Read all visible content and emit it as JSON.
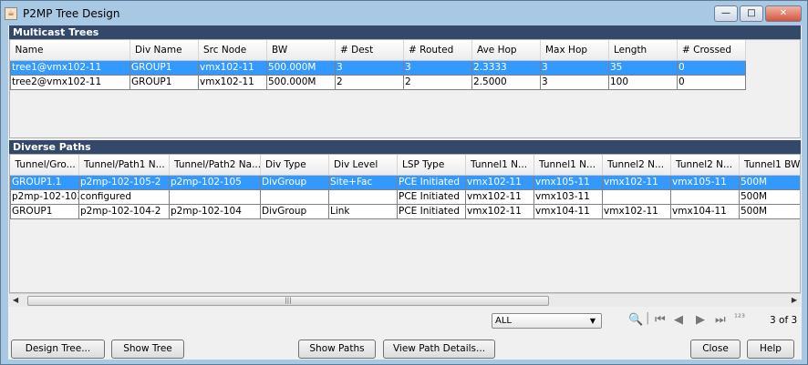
{
  "window": {
    "title": "P2MP Tree Design",
    "minimize": "—",
    "maximize": "□",
    "close": "✕"
  },
  "multicast": {
    "title": "Multicast Trees",
    "columns": [
      "Name",
      "Div Name",
      "Src Node",
      "BW",
      "# Dest",
      "# Routed",
      "Ave Hop",
      "Max Hop",
      "Length",
      "# Crossed"
    ],
    "rows": [
      [
        "tree1@vmx102-11",
        "GROUP1",
        "vmx102-11",
        "500.000M",
        "3",
        "3",
        "2.3333",
        "3",
        "35",
        "0"
      ],
      [
        "tree2@vmx102-11",
        "GROUP1",
        "vmx102-11",
        "500.000M",
        "2",
        "2",
        "2.5000",
        "3",
        "100",
        "0"
      ]
    ],
    "selected_row": 0
  },
  "diverse": {
    "title": "Diverse Paths",
    "columns": [
      "Tunnel/Gro...",
      "Tunnel/Path1 N...",
      "Tunnel/Path2 Na...",
      "Div Type",
      "Div Level",
      "LSP Type",
      "Tunnel1 N...",
      "Tunnel1 N...",
      "Tunnel2 N...",
      "Tunnel2 N...",
      "Tunnel1 BW"
    ],
    "rows": [
      [
        "GROUP1.1",
        "p2mp-102-105-2",
        "p2mp-102-105",
        "DivGroup",
        "Site+Fac",
        "PCE Initiated",
        "vmx102-11",
        "vmx105-11",
        "vmx102-11",
        "vmx105-11",
        "500M"
      ],
      [
        "p2mp-102-103",
        "configured",
        "",
        "",
        "",
        "PCE Initiated",
        "vmx102-11",
        "vmx103-11",
        "",
        "",
        "500M"
      ],
      [
        "GROUP1",
        "p2mp-102-104-2",
        "p2mp-102-104",
        "DivGroup",
        "Link",
        "PCE Initiated",
        "vmx102-11",
        "vmx104-11",
        "vmx102-11",
        "vmx104-11",
        "500M"
      ]
    ],
    "selected_row": 0
  },
  "toolbar": {
    "filter_value": "ALL",
    "page_count": "3 of 3",
    "icons": [
      "search-add-icon",
      "first-icon",
      "prev-icon",
      "next-icon",
      "last-icon",
      "page-number-icon"
    ]
  },
  "buttons": {
    "design_tree": "Design Tree...",
    "show_tree": "Show Tree",
    "show_paths": "Show Paths",
    "view_path_details": "View Path Details...",
    "close": "Close",
    "help": "Help"
  }
}
